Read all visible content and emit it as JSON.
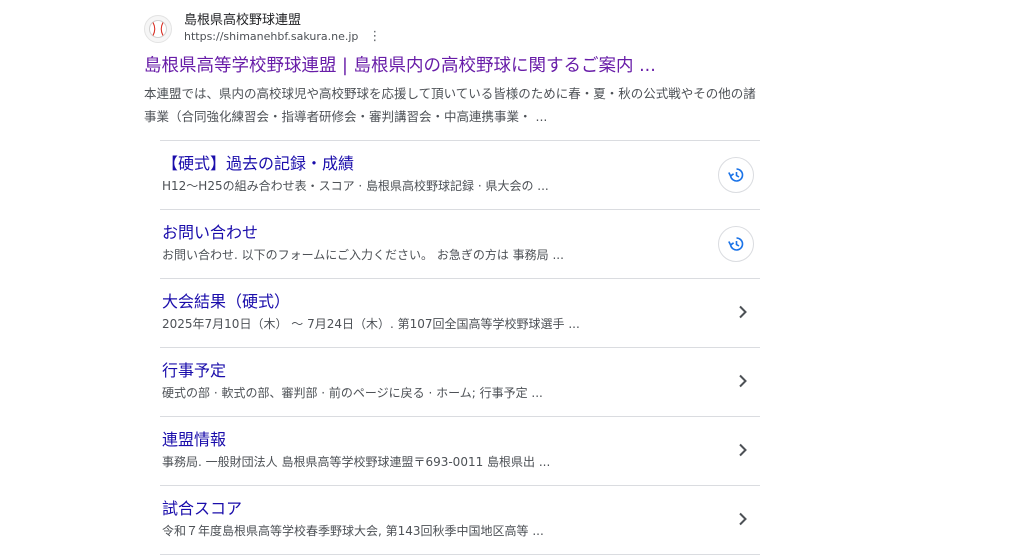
{
  "result": {
    "site_name": "島根県高校野球連盟",
    "site_url": "https://shimanehbf.sakura.ne.jp",
    "more_icon": "⋮",
    "title": "島根県高等学校野球連盟 | 島根県内の高校野球に関するご案内 ...",
    "snippet": "本連盟では、県内の高校球児や高校野球を応援して頂いている皆様のために春・夏・秋の公式戦やその他の諸事業（合同強化練習会・指導者研修会・審判講習会・中高連携事業・ ...",
    "colors": {
      "visited_title": "#681da8",
      "link": "#1a0dab",
      "icon_blue": "#1a73e8"
    }
  },
  "sitelinks": [
    {
      "title": "【硬式】過去の記録・成績",
      "snippet": "H12〜H25の組み合わせ表・スコア · 島根県高校野球記録 · 県大会の ...",
      "icon": "history-icon"
    },
    {
      "title": "お問い合わせ",
      "snippet": "お問い合わせ. 以下のフォームにご入力ください。 お急ぎの方は 事務局 ...",
      "icon": "history-icon"
    },
    {
      "title": "大会結果（硬式）",
      "snippet": "2025年7月10日（木） 〜 7月24日（木）. 第107回全国高等学校野球選手 ...",
      "icon": "chevron-right-icon"
    },
    {
      "title": "行事予定",
      "snippet": "硬式の部 · 軟式の部、審判部 · 前のページに戻る · ホーム; 行事予定 ...",
      "icon": "chevron-right-icon"
    },
    {
      "title": "連盟情報",
      "snippet": "事務局. 一般財団法人 島根県高等学校野球連盟〒693-0011 島根県出 ...",
      "icon": "chevron-right-icon"
    },
    {
      "title": "試合スコア",
      "snippet": "令和７年度島根県高等学校春季野球大会, 第143回秋季中国地区高等 ...",
      "icon": "chevron-right-icon"
    }
  ]
}
